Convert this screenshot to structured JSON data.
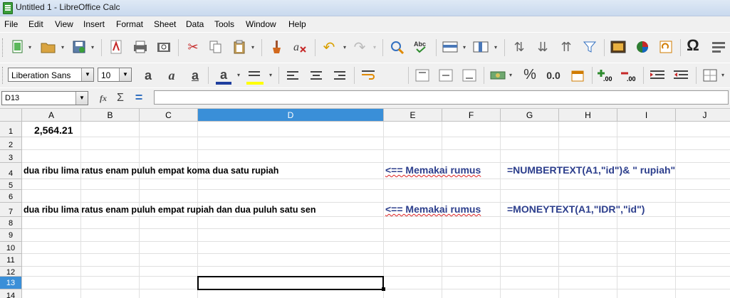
{
  "window": {
    "title": "Untitled 1 - LibreOffice Calc"
  },
  "menu": [
    {
      "label": "File",
      "u": "F",
      "rest": "ile"
    },
    {
      "label": "Edit",
      "u": "E",
      "rest": "dit"
    },
    {
      "label": "View",
      "u": "V",
      "rest": "iew"
    },
    {
      "label": "Insert",
      "u": "I",
      "rest": "nsert"
    },
    {
      "label": "Format",
      "u": "F",
      "rest": "ormat",
      "pre": "",
      "alt": "Form",
      "u2": "a",
      "rest2": "t"
    },
    {
      "label": "Sheet",
      "u": "S",
      "rest": "heet"
    },
    {
      "label": "Data",
      "u": "D",
      "rest": "ata"
    },
    {
      "label": "Tools",
      "u": "T",
      "rest": "ools"
    },
    {
      "label": "Window",
      "u": "W",
      "rest": "indow"
    },
    {
      "label": "Help",
      "u": "H",
      "rest": "elp"
    }
  ],
  "format": {
    "font_name": "Liberation Sans",
    "font_size": "10",
    "percent_label": "%",
    "decimal_label": "0.0",
    "font_color": "#1f3f9f",
    "highlight_color": "#ffff00"
  },
  "name_box": "D13",
  "formula_icons": {
    "function": "fx",
    "sum": "Σ",
    "equals": "="
  },
  "columns": [
    "A",
    "B",
    "C",
    "D",
    "E",
    "F",
    "G",
    "H",
    "I",
    "J"
  ],
  "rows": [
    "1",
    "2",
    "3",
    "4",
    "5",
    "6",
    "7",
    "8",
    "9",
    "10",
    "11",
    "12",
    "13",
    "14"
  ],
  "active_cell": {
    "column": "D",
    "row": "13"
  },
  "cells": {
    "A1": "2,564.21",
    "A4": "dua ribu lima ratus enam puluh empat koma dua satu rupiah",
    "E4_note": "<== Memakai rumus",
    "G4_formula": "=NUMBERTEXT(A1,\"id\")& \" rupiah\"",
    "A7": "dua ribu lima ratus enam puluh empat rupiah dan dua puluh satu sen",
    "E7_note": "<== Memakai rumus",
    "G7_formula": "=MONEYTEXT(A1,\"IDR\",\"id\")"
  }
}
